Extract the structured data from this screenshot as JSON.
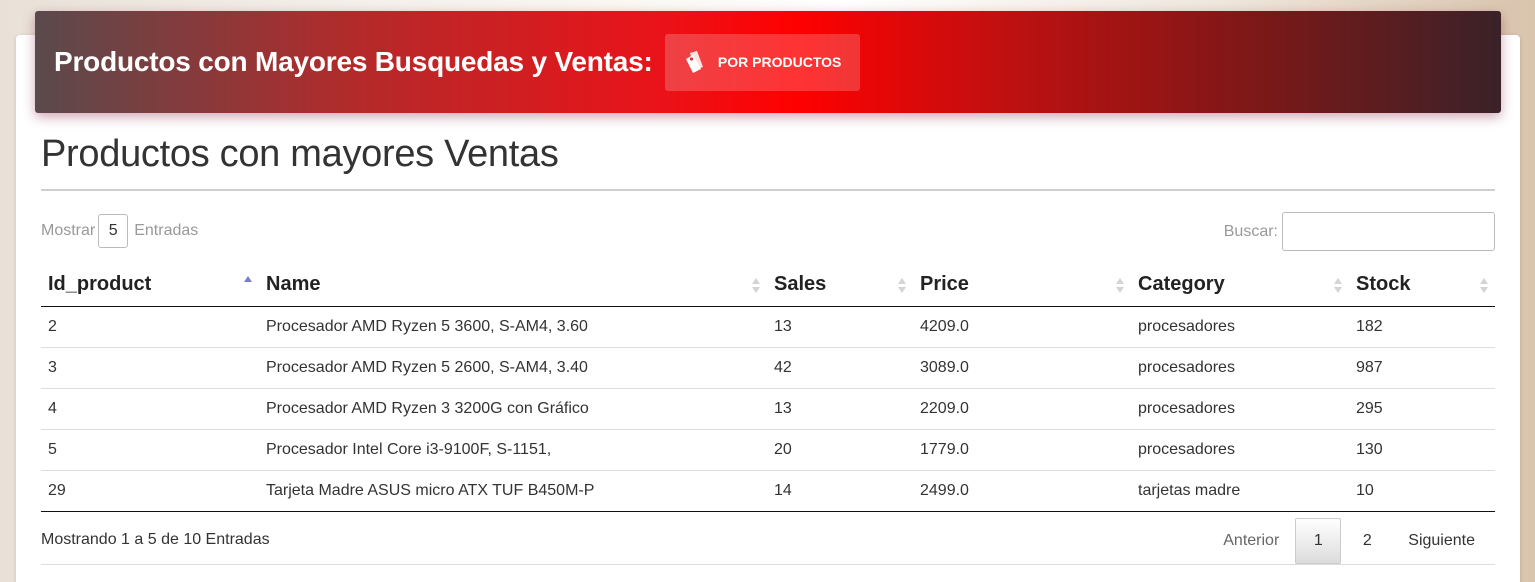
{
  "header": {
    "title": "Productos con Mayores Busquedas y Ventas:",
    "button_label": "POR PRODUCTOS",
    "button_icon": "tags-icon",
    "accent_color": "#ff0000"
  },
  "section": {
    "title": "Productos con mayores Ventas"
  },
  "controls": {
    "show_label": "Mostrar",
    "length_value": "5",
    "entries_label": "Entradas",
    "search_label": "Buscar:",
    "search_value": ""
  },
  "table": {
    "columns": [
      {
        "label": "Id_product",
        "sort": "asc"
      },
      {
        "label": "Name",
        "sort": "none"
      },
      {
        "label": "Sales",
        "sort": "none"
      },
      {
        "label": "Price",
        "sort": "none"
      },
      {
        "label": "Category",
        "sort": "none"
      },
      {
        "label": "Stock",
        "sort": "none"
      }
    ],
    "rows": [
      [
        "2",
        "Procesador AMD Ryzen 5 3600, S-AM4, 3.60",
        "13",
        "4209.0",
        "procesadores",
        "182"
      ],
      [
        "3",
        "Procesador AMD Ryzen 5 2600, S-AM4, 3.40",
        "42",
        "3089.0",
        "procesadores",
        "987"
      ],
      [
        "4",
        "Procesador AMD Ryzen 3 3200G con Gráfico",
        "13",
        "2209.0",
        "procesadores",
        "295"
      ],
      [
        "5",
        "Procesador Intel Core i3-9100F, S-1151,",
        "20",
        "1779.0",
        "procesadores",
        "130"
      ],
      [
        "29",
        "Tarjeta Madre ASUS micro ATX TUF B450M-P",
        "14",
        "2499.0",
        "tarjetas madre",
        "10"
      ]
    ]
  },
  "footer": {
    "info": "Mostrando 1 a 5 de 10 Entradas",
    "prev_label": "Anterior",
    "pages": [
      "1",
      "2"
    ],
    "current_page": "1",
    "next_label": "Siguiente"
  }
}
